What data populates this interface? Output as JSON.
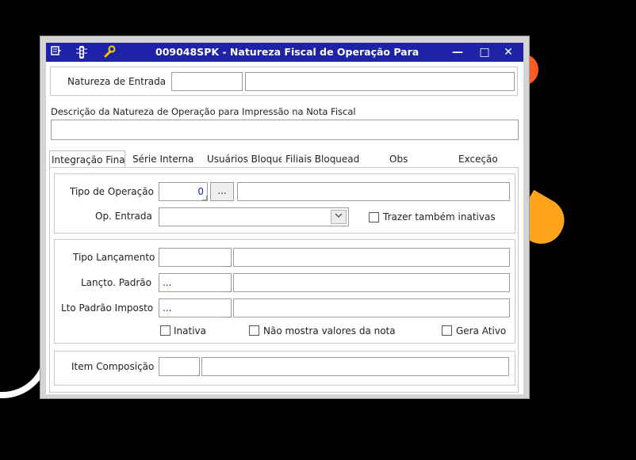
{
  "window": {
    "title": "009048SPK - Natureza Fiscal de Operação Para",
    "icons": [
      "list-icon",
      "traffic-light-icon",
      "wrench-icon"
    ],
    "controls": {
      "minimize": "—",
      "maximize": "□",
      "close": "✕"
    }
  },
  "header": {
    "natureza_label": "Natureza de Entrada",
    "natureza_code": "",
    "natureza_desc": "",
    "descricao_label": "Descrição da Natureza de Operação para Impressão na Nota Fiscal",
    "descricao_value": ""
  },
  "tabs": [
    {
      "label": "Integração Fina"
    },
    {
      "label": "Série Interna"
    },
    {
      "label": "Usuários Bloque"
    },
    {
      "label": "Filiais Bloqueada"
    },
    {
      "label": "Obs"
    },
    {
      "label": "Exceção"
    }
  ],
  "integracao": {
    "tipo_operacao_label": "Tipo de Operação",
    "tipo_operacao_value": "0",
    "tipo_operacao_button": "...",
    "tipo_operacao_desc": "",
    "op_entrada_label": "Op. Entrada",
    "op_entrada_value": "",
    "trazer_inativas_label": "Trazer também inativas",
    "tipo_lancamento_label": "Tipo Lançamento",
    "tipo_lancamento_value": "",
    "tipo_lancamento_desc": "",
    "lancto_padrao_label": "Lançto. Padrão",
    "lancto_padrao_value": "...",
    "lancto_padrao_desc": "",
    "lto_padrao_imposto_label": "Lto Padrão Imposto",
    "lto_padrao_imposto_value": "...",
    "lto_padrao_imposto_desc": "",
    "inativa_label": "Inativa",
    "nao_mostra_label": "Não mostra valores da nota",
    "gera_ativo_label": "Gera Ativo",
    "item_composicao_label": "Item Composição",
    "item_composicao_value": "",
    "item_composicao_desc": ""
  },
  "colors": {
    "titlebar": "#1e22a6",
    "background": "#000000",
    "accent_shape": "#ff7a00"
  }
}
